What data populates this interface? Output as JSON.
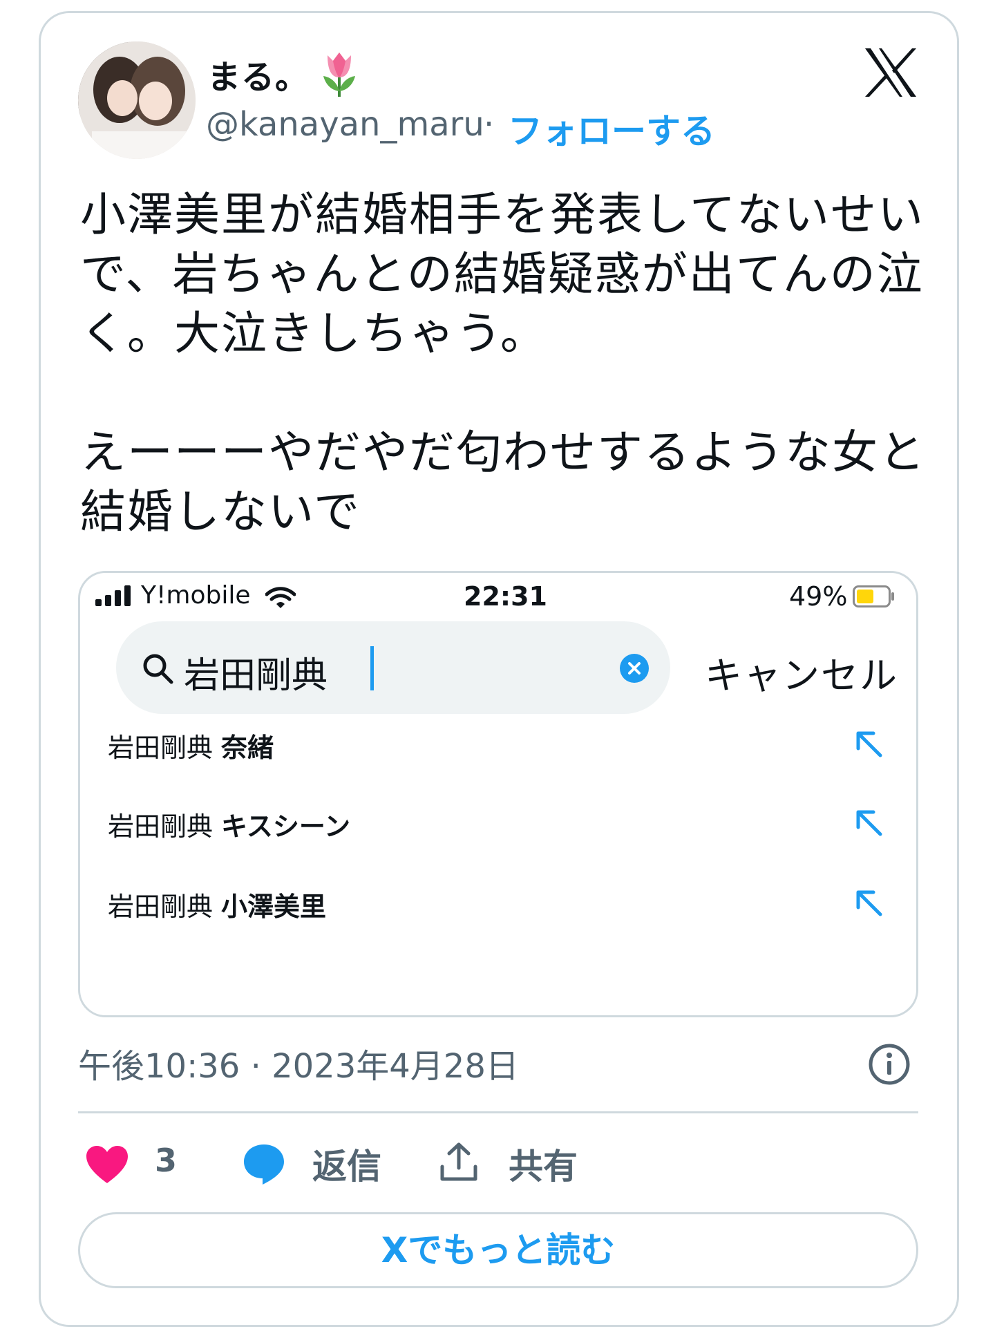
{
  "author": {
    "name": "まる。",
    "name_emoji": "tulip-emoji",
    "handle": "@kanayan_maru",
    "separator": "·",
    "follow_label": "フォローする",
    "avatar": "avatar-photo"
  },
  "brand_icon": "x-logo-icon",
  "tweet": {
    "text": "小澤美里が結婚相手を発表してないせいで、岩ちゃんとの結婚疑惑が出てんの泣く。大泣きしちゃう。\n\nえーーーやだやだ匂わせするような女と結婚しないで"
  },
  "screenshot": {
    "status_bar": {
      "carrier": "Y!mobile",
      "time": "22:31",
      "battery": "49%"
    },
    "search": {
      "query": "岩田剛典",
      "cancel_label": "キャンセル"
    },
    "suggestions": [
      {
        "base": "岩田剛典",
        "bold": "奈緒"
      },
      {
        "base": "岩田剛典",
        "bold": "キスシーン"
      },
      {
        "base": "岩田剛典",
        "bold": "小澤美里"
      }
    ]
  },
  "meta": {
    "timestamp": "午後10:36 · 2023年4月28日"
  },
  "actions": {
    "like_count": "3",
    "reply_label": "返信",
    "share_label": "共有"
  },
  "read_more_label": "Xでもっと読む",
  "colors": {
    "accent": "#1d9bf0",
    "like": "#f91880",
    "muted": "#536471",
    "border": "#cfd9de"
  }
}
